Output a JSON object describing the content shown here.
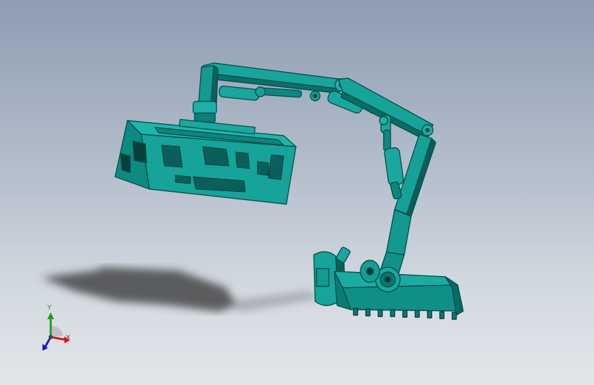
{
  "viewport": {
    "model_color": "#0e9e96",
    "model_dark": "#06635e",
    "model_light": "#25c2b8",
    "background_top": "#8e9db2",
    "background_bottom": "#e2e6ea"
  },
  "triad": {
    "x_label": "X",
    "y_label": "Y",
    "x_color": "#d01818",
    "y_color": "#1aa01a",
    "z_color": "#1818c8"
  }
}
